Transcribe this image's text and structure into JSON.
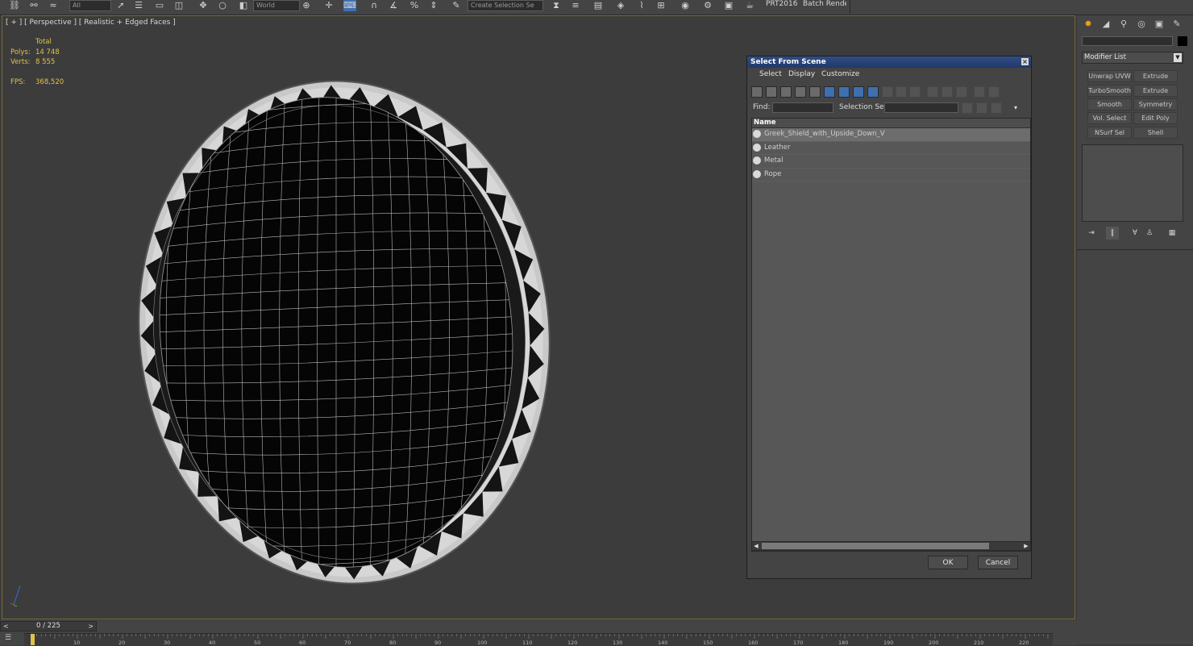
{
  "toolbar": {
    "combo_all": "All",
    "combo_coord": "World",
    "combo_selset": "Create Selection Se",
    "prt_label": "PRT2016",
    "batch_render_label": "Batch Render..."
  },
  "viewport": {
    "label": "[ + ] [ Perspective ] [ Realistic + Edged Faces ]",
    "stats": {
      "total_label": "Total",
      "polys_label": "Polys:",
      "polys_value": "14 748",
      "verts_label": "Verts:",
      "verts_value": "8 555",
      "fps_label": "FPS:",
      "fps_value": "368,520"
    }
  },
  "dialog": {
    "title": "Select From Scene",
    "close_glyph": "×",
    "menu": [
      "Select",
      "Display",
      "Customize"
    ],
    "find_label": "Find:",
    "find_value": "",
    "selection_set_label": "Selection Set:",
    "selection_set_value": "",
    "column_header": "Name",
    "rows": [
      {
        "name": "Greek_Shield_with_Upside_Down_V",
        "selected": true
      },
      {
        "name": "Leather",
        "selected": false
      },
      {
        "name": "Metal",
        "selected": false
      },
      {
        "name": "Rope",
        "selected": false
      }
    ],
    "ok_label": "OK",
    "cancel_label": "Cancel"
  },
  "command_panel": {
    "name_value": "",
    "modifier_list_label": "Modifier List",
    "buttons": [
      "Unwrap UVW",
      "Extrude",
      "TurboSmooth",
      "Extrude",
      "Smooth",
      "Symmetry",
      "Vol. Select",
      "Edit Poly",
      "NSurf Sel",
      "Shell"
    ]
  },
  "timeline": {
    "frame_text": "0 / 225",
    "prev_glyph": "<",
    "next_glyph": ">",
    "ticks": [
      "10",
      "20",
      "30",
      "40",
      "50",
      "60",
      "70",
      "80",
      "90",
      "100",
      "110",
      "120",
      "130",
      "140",
      "150",
      "160",
      "170",
      "180",
      "190",
      "200",
      "210",
      "220"
    ]
  },
  "colors": {
    "stats_text": "#e2c14a",
    "dialog_title_bg": "#2f4d86",
    "viewport_border": "#7a6a3a"
  }
}
